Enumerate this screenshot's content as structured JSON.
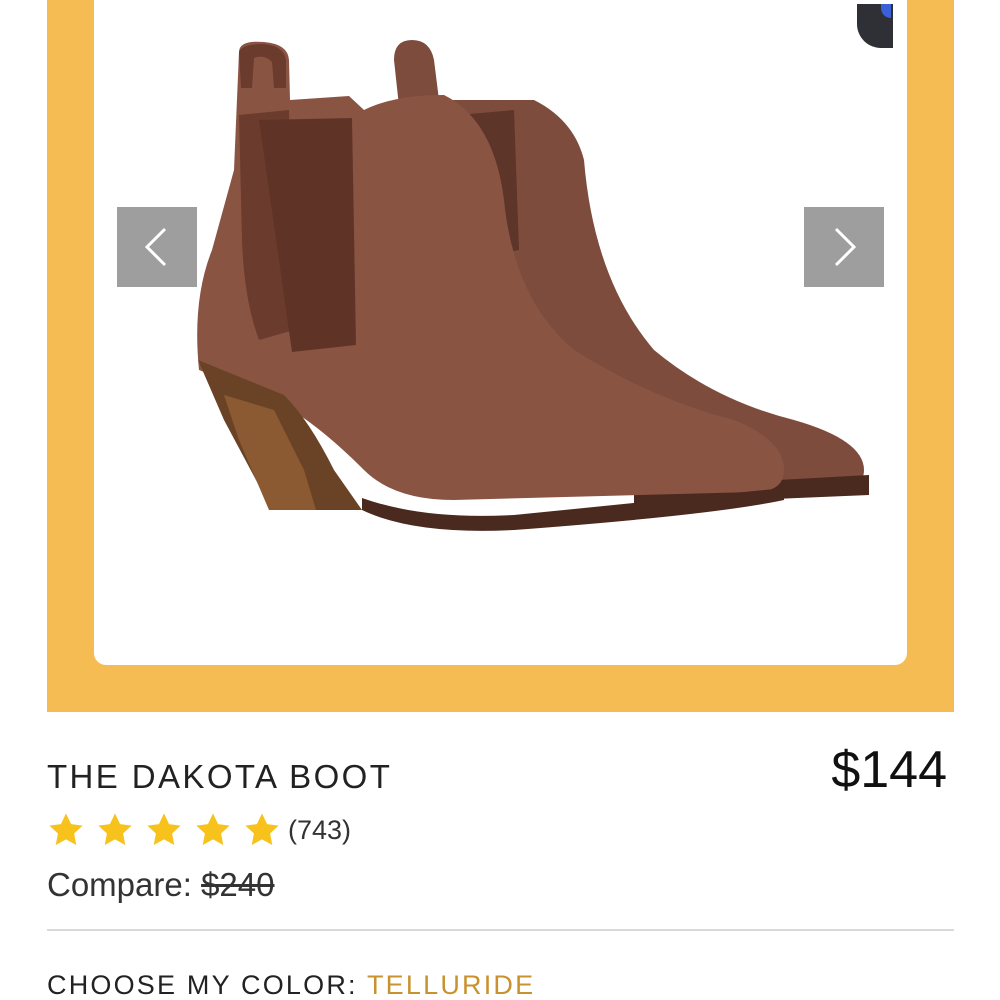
{
  "product": {
    "title": "THE DAKOTA BOOT",
    "price": "$144",
    "rating": {
      "stars": 5,
      "review_count": "(743)"
    },
    "compare_label": "Compare:",
    "compare_price": "$240"
  },
  "color_selector": {
    "label": "CHOOSE MY COLOR:",
    "selected": "TELLURIDE"
  },
  "colors": {
    "gallery_frame": "#f5bc53",
    "star": "#f7c21b",
    "selected_color_text": "#c8922e",
    "boot_leather": "#8a5443"
  },
  "icons": {
    "prev": "chevron-left-icon",
    "next": "chevron-right-icon",
    "star": "star-icon"
  }
}
